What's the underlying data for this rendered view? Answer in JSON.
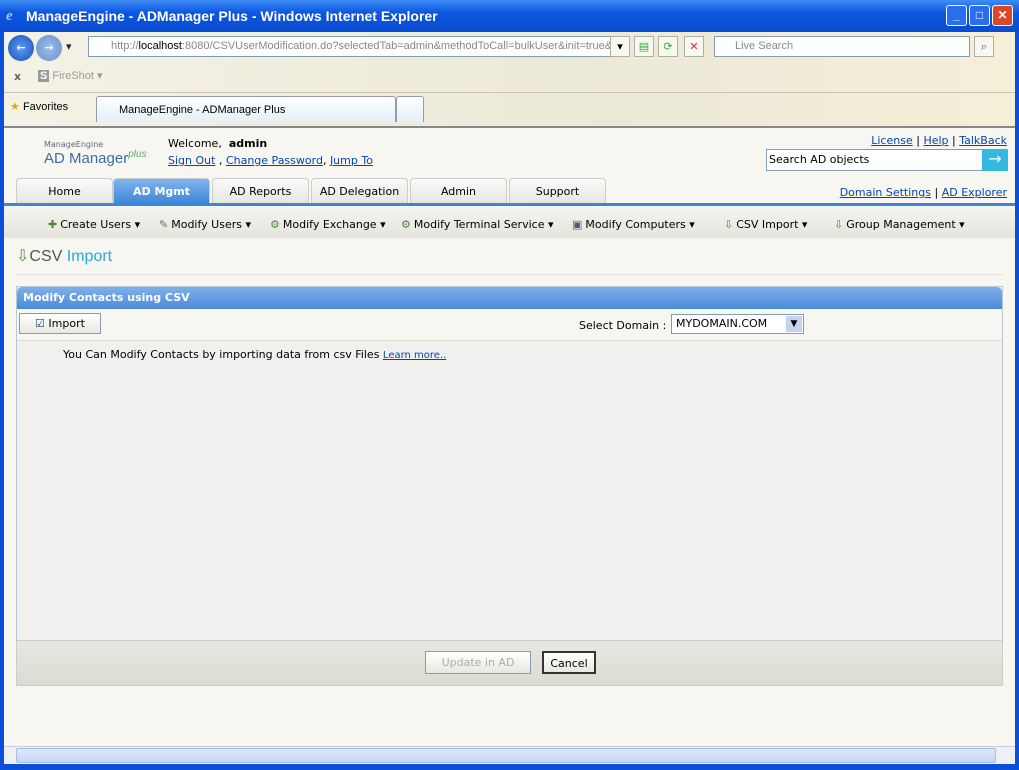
{
  "window": {
    "title": "ManageEngine - ADManager Plus - Windows Internet Explorer"
  },
  "browser": {
    "url_host": "localhost",
    "url_pre": "http://",
    "url_post": ":8080/CSVUserModification.do?selectedTab=admin&methodToCall=bulkUser&init=true&",
    "search_placeholder": "Live Search",
    "toolbar_addon": "FireShot",
    "favorites": "Favorites",
    "tab_title": "ManageEngine - ADManager Plus"
  },
  "header": {
    "logo_top": "ManageEngine",
    "logo_main": "AD Manager",
    "logo_plus": "plus",
    "welcome": "Welcome,",
    "user": "admin",
    "sign_out": "Sign Out",
    "change_password": "Change Password",
    "jump_to": "Jump To",
    "license": "License",
    "help": "Help",
    "talkback": "TalkBack",
    "search_placeholder": "Search AD objects",
    "domain_settings": "Domain Settings",
    "ad_explorer": "AD Explorer"
  },
  "tabs": [
    "Home",
    "AD Mgmt",
    "AD Reports",
    "AD Delegation",
    "Admin",
    "Support"
  ],
  "submenu": [
    "Create Users",
    "Modify Users",
    "Modify Exchange",
    "Modify Terminal Service",
    "Modify Computers",
    "CSV Import",
    "Group Management"
  ],
  "page": {
    "title_a": "CSV",
    "title_b": "Import",
    "panel_title": "Modify Contacts using CSV",
    "import": "Import",
    "select_domain": "Select Domain :",
    "domain_value": "MYDOMAIN.COM",
    "info": "You Can Modify Contacts by importing data from csv Files",
    "learn_more": "Learn more..",
    "update": "Update in AD",
    "cancel": "Cancel"
  }
}
